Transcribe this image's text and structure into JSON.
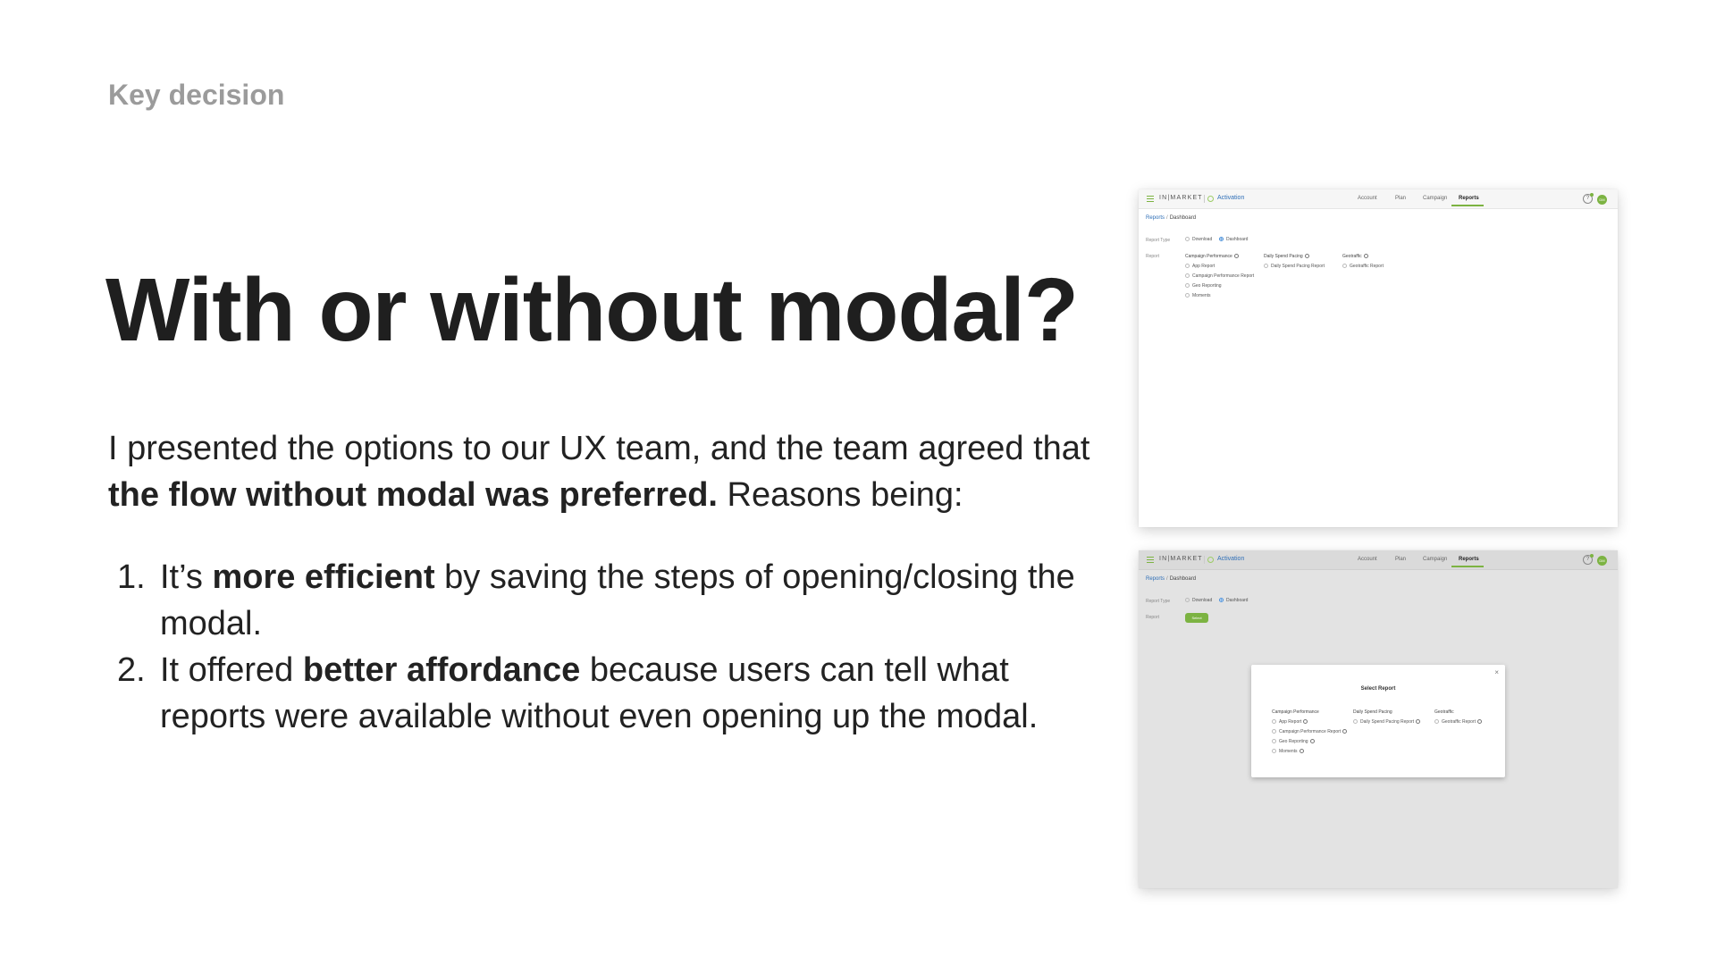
{
  "slide": {
    "eyebrow": "Key decision",
    "headline": "With or without modal?",
    "intro_lead": "I presented the options to our UX team, and the team agreed that",
    "intro_bold": "the flow without modal was preferred.",
    "intro_tail": "Reasons being:",
    "reasons": [
      {
        "num": "1.",
        "pre": "It’s",
        "bold": "more efficient",
        "post": "by saving the steps of opening/closing the modal."
      },
      {
        "num": "2.",
        "pre": "It offered",
        "bold": "better affordance",
        "post": "because users can tell what reports were available without even opening up the modal."
      }
    ]
  },
  "mockup": {
    "brand": "IN|MARKET",
    "product": "Activation",
    "nav": [
      "Account",
      "Plan",
      "Campaign",
      "Reports"
    ],
    "avatar": "DM",
    "help": "?",
    "breadcrumb": [
      "Reports",
      "/",
      "Dashboard"
    ],
    "report_type_label": "Report Type",
    "report_type_options": [
      "Download",
      "Dashboard"
    ],
    "report_label": "Report",
    "columns": [
      {
        "title": "Campaign Performance",
        "items": [
          "App Report",
          "Campaign Performance Report",
          "Geo Reporting",
          "Moments"
        ]
      },
      {
        "title": "Daily Spend Pacing",
        "items": [
          "Daily Spend Pacing Report"
        ]
      },
      {
        "title": "Geotraffic",
        "items": [
          "Geotraffic Report"
        ]
      }
    ],
    "select_button": "Select",
    "modal_title": "Select Report",
    "modal_close": "×",
    "colors": {
      "accent": "#7cb342",
      "link": "#2f6fb7"
    }
  }
}
